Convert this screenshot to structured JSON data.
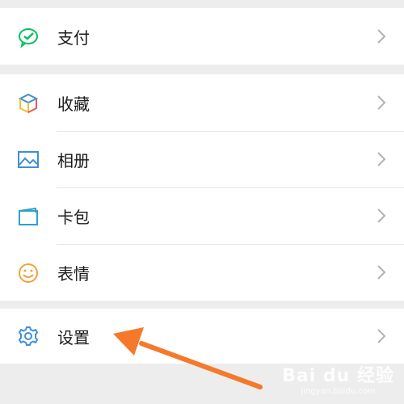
{
  "menu": {
    "pay": {
      "label": "支付",
      "icon": "wechat-pay-icon",
      "color": "#07c160"
    },
    "items": [
      {
        "label": "收藏",
        "icon": "favorites-cube-icon"
      },
      {
        "label": "相册",
        "icon": "album-picture-icon"
      },
      {
        "label": "卡包",
        "icon": "card-wallet-icon"
      },
      {
        "label": "表情",
        "icon": "sticker-smiley-icon"
      }
    ],
    "settings": {
      "label": "设置",
      "icon": "gear-icon"
    }
  },
  "annotation": {
    "arrow_color": "#f5792a"
  },
  "watermark": {
    "brand": "Bai du 经验",
    "url": "jingyan.baidu.com"
  }
}
